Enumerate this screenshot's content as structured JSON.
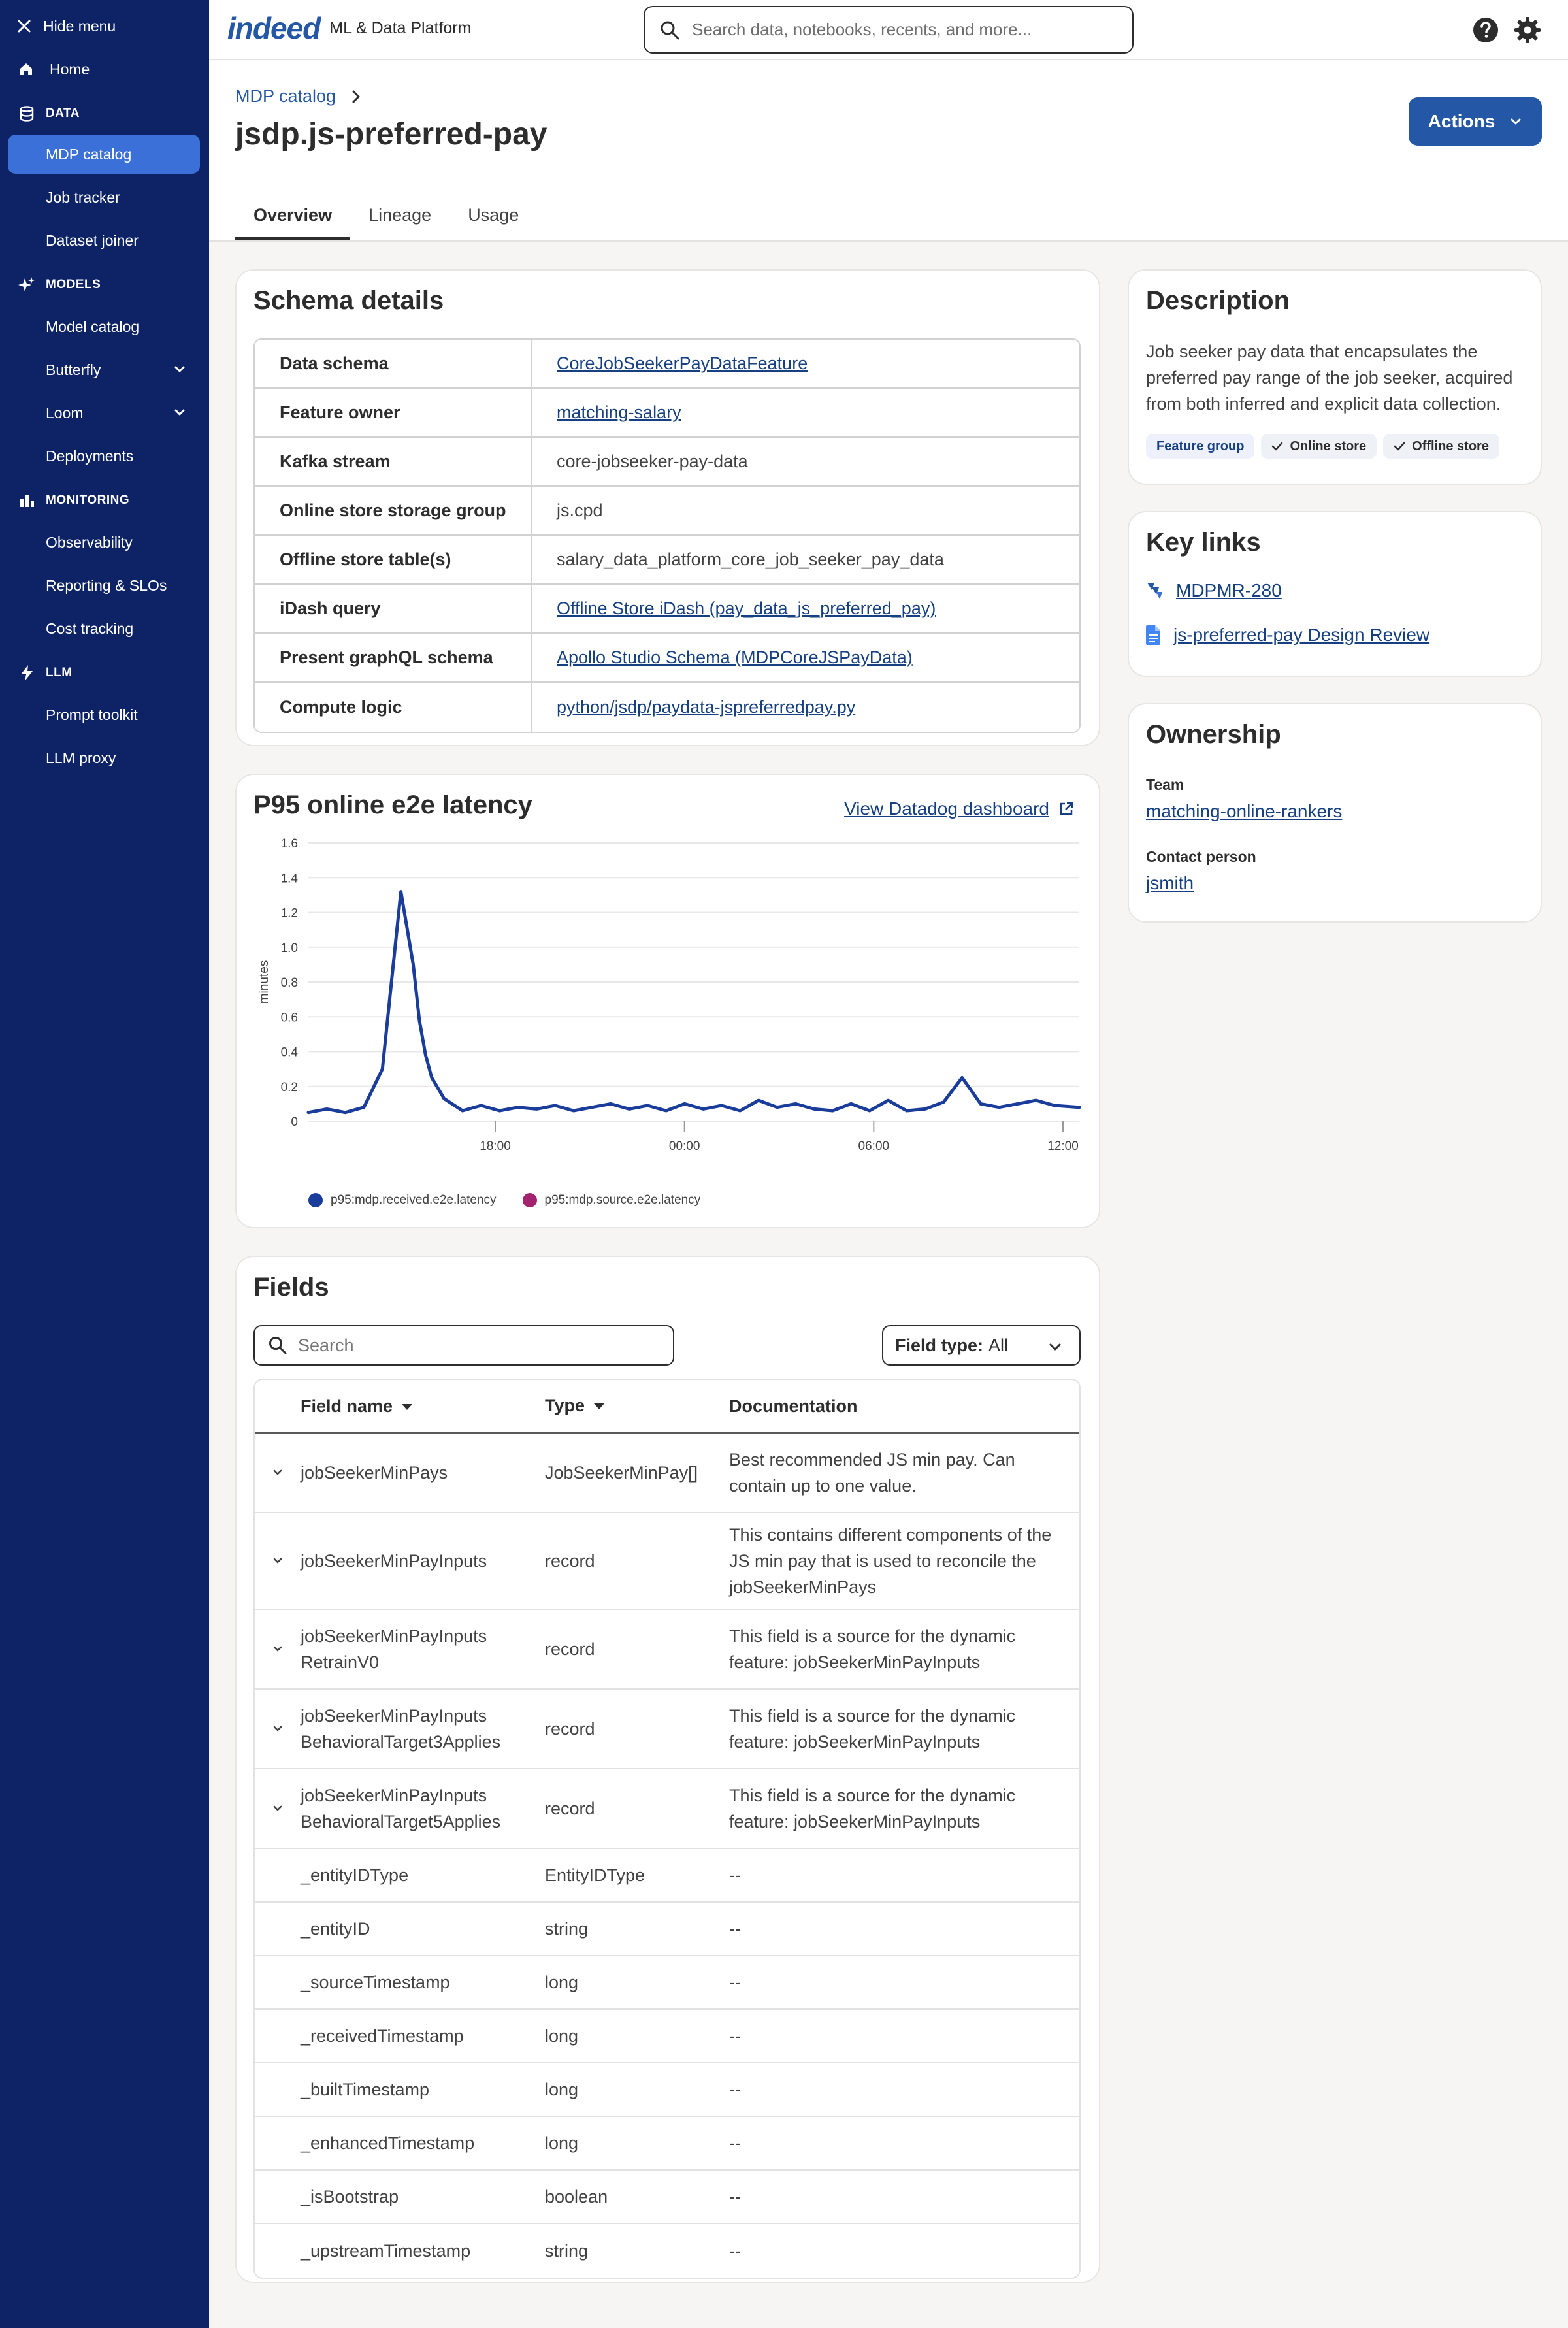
{
  "sidebar": {
    "hide_menu": "Hide menu",
    "home": "Home",
    "sections": [
      {
        "title": "DATA",
        "items": [
          "MDP catalog",
          "Job tracker",
          "Dataset joiner"
        ]
      },
      {
        "title": "MODELS",
        "items": [
          "Model catalog",
          "Butterfly",
          "Loom",
          "Deployments"
        ]
      },
      {
        "title": "MONITORING",
        "items": [
          "Observability",
          "Reporting & SLOs",
          "Cost tracking"
        ]
      },
      {
        "title": "LLM",
        "items": [
          "Prompt toolkit",
          "LLM proxy"
        ]
      }
    ],
    "active_item": "MDP catalog"
  },
  "topbar": {
    "logo": "indeed",
    "platform_name": "ML & Data Platform",
    "search_placeholder": "Search data, notebooks, recents, and more..."
  },
  "header": {
    "breadcrumb": "MDP catalog",
    "title": "jsdp.js-preferred-pay",
    "actions_label": "Actions",
    "tabs": [
      "Overview",
      "Lineage",
      "Usage"
    ],
    "active_tab": "Overview"
  },
  "schema": {
    "title": "Schema details",
    "rows": [
      {
        "key": "Data schema",
        "value": "CoreJobSeekerPayDataFeature",
        "link": true
      },
      {
        "key": "Feature owner",
        "value": "matching-salary",
        "link": true
      },
      {
        "key": "Kafka stream",
        "value": "core-jobseeker-pay-data",
        "link": false
      },
      {
        "key": "Online store storage group",
        "value": "js.cpd",
        "link": false
      },
      {
        "key": "Offline store table(s)",
        "value": "salary_data_platform_core_job_seeker_pay_data",
        "link": false
      },
      {
        "key": "iDash query",
        "value": "Offline Store iDash (pay_data_js_preferred_pay)",
        "link": true
      },
      {
        "key": "Present graphQL schema",
        "value": "Apollo Studio Schema (MDPCoreJSPayData)",
        "link": true
      },
      {
        "key": "Compute logic",
        "value": "python/jsdp/paydata-jspreferredpay.py",
        "link": true
      }
    ]
  },
  "latency": {
    "title": "P95 online e2e latency",
    "dashboard_link": "View Datadog dashboard"
  },
  "chart_data": {
    "type": "line",
    "ylabel": "minutes",
    "ylim": [
      0,
      1.6
    ],
    "y_ticks": [
      "0",
      "0.2",
      "0.4",
      "0.6",
      "0.8",
      "1.0",
      "1.2",
      "1.4",
      "1.6"
    ],
    "x_ticks": [
      "18:00",
      "00:00",
      "06:00",
      "12:00"
    ],
    "x_range_hours": [
      12.0,
      24.5
    ],
    "series": [
      {
        "name": "p95:mdp.received.e2e.latency",
        "color": "#1a3d9c",
        "x": [
          12.0,
          12.3,
          12.6,
          12.9,
          13.2,
          13.5,
          13.7,
          13.8,
          13.9,
          14.0,
          14.2,
          14.5,
          14.8,
          15.1,
          15.4,
          15.7,
          16.0,
          16.3,
          16.6,
          16.9,
          17.2,
          17.5,
          17.8,
          18.1,
          18.4,
          18.7,
          19.0,
          19.3,
          19.6,
          19.9,
          20.2,
          20.5,
          20.8,
          21.1,
          21.4,
          21.7,
          22.0,
          22.3,
          22.6,
          22.9,
          23.2,
          23.5,
          23.8,
          24.1,
          24.5
        ],
        "y": [
          0.05,
          0.07,
          0.05,
          0.08,
          0.3,
          1.32,
          0.9,
          0.58,
          0.38,
          0.25,
          0.13,
          0.06,
          0.09,
          0.06,
          0.08,
          0.07,
          0.09,
          0.06,
          0.08,
          0.1,
          0.07,
          0.09,
          0.06,
          0.1,
          0.07,
          0.09,
          0.06,
          0.12,
          0.08,
          0.1,
          0.07,
          0.06,
          0.1,
          0.06,
          0.12,
          0.06,
          0.07,
          0.11,
          0.25,
          0.1,
          0.08,
          0.1,
          0.12,
          0.09,
          0.08
        ]
      },
      {
        "name": "p95:mdp.source.e2e.latency",
        "color": "#a3236e",
        "x": [],
        "y": []
      }
    ]
  },
  "description": {
    "title": "Description",
    "text": "Job seeker pay data that encapsulates the preferred pay range of the job seeker, acquired from both inferred and explicit data collection.",
    "tags": [
      "Feature group",
      "Online store",
      "Offline store"
    ]
  },
  "key_links": {
    "title": "Key links",
    "links": [
      "MDPMR-280",
      "js-preferred-pay Design Review"
    ]
  },
  "ownership": {
    "title": "Ownership",
    "team_label": "Team",
    "team": "matching-online-rankers",
    "contact_label": "Contact person",
    "contact": "jsmith"
  },
  "fields": {
    "title": "Fields",
    "search_placeholder": "Search",
    "field_type_label": "Field type:",
    "field_type_value": "All",
    "columns": [
      "Field name",
      "Type",
      "Documentation"
    ],
    "rows": [
      {
        "name": "jobSeekerMinPays",
        "type": "JobSeekerMinPay[]",
        "doc": "Best recommended JS min pay. Can contain up to one value.",
        "expandable": true
      },
      {
        "name": "jobSeekerMinPayInputs",
        "type": "record",
        "doc": "This contains different components of the JS min pay that is used to reconcile the jobSeekerMinPays",
        "expandable": true
      },
      {
        "name": "jobSeekerMinPayInputs RetrainV0",
        "type": "record",
        "doc": "This field is a source for the dynamic feature: jobSeekerMinPayInputs",
        "expandable": true
      },
      {
        "name": "jobSeekerMinPayInputs BehavioralTarget3Applies",
        "type": "record",
        "doc": "This field is a source for the dynamic feature: jobSeekerMinPayInputs",
        "expandable": true
      },
      {
        "name": "jobSeekerMinPayInputs BehavioralTarget5Applies",
        "type": "record",
        "doc": "This field is a source for the dynamic feature: jobSeekerMinPayInputs",
        "expandable": true
      },
      {
        "name": "_entityIDType",
        "type": "EntityIDType",
        "doc": "--",
        "expandable": false
      },
      {
        "name": "_entityID",
        "type": "string",
        "doc": "--",
        "expandable": false
      },
      {
        "name": "_sourceTimestamp",
        "type": "long",
        "doc": "--",
        "expandable": false
      },
      {
        "name": "_receivedTimestamp",
        "type": "long",
        "doc": "--",
        "expandable": false
      },
      {
        "name": "_builtTimestamp",
        "type": "long",
        "doc": "--",
        "expandable": false
      },
      {
        "name": "_enhancedTimestamp",
        "type": "long",
        "doc": "--",
        "expandable": false
      },
      {
        "name": "_isBootstrap",
        "type": "boolean",
        "doc": "--",
        "expandable": false
      },
      {
        "name": "_upstreamTimestamp",
        "type": "string",
        "doc": "--",
        "expandable": false
      }
    ]
  }
}
